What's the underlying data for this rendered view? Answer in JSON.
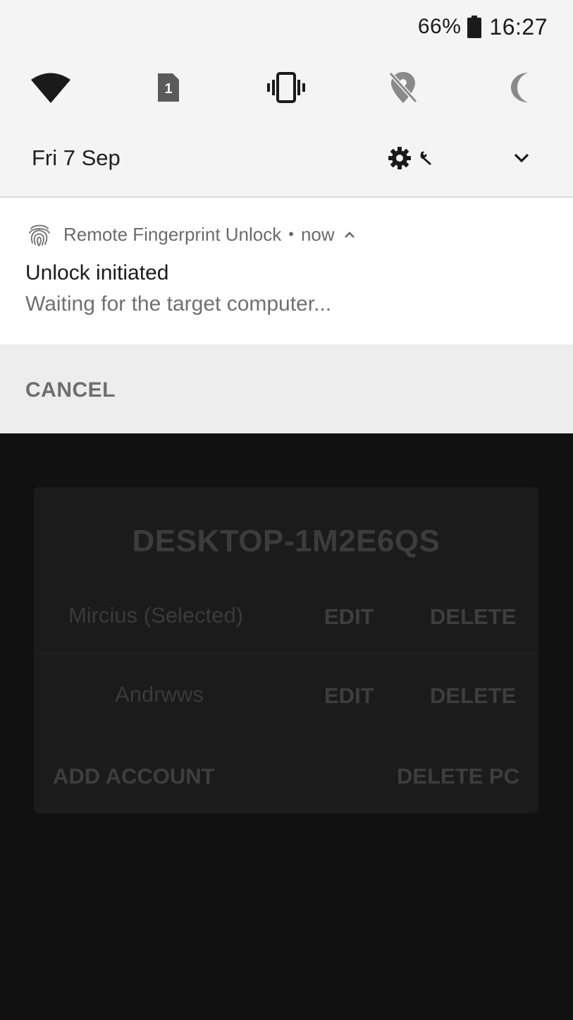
{
  "status_bar": {
    "battery_percent": "66%",
    "time": "16:27",
    "battery_icon": "battery-icon"
  },
  "quick_settings": {
    "tiles": [
      {
        "icon": "wifi-icon",
        "state": "on"
      },
      {
        "icon": "sim-card-icon",
        "label": "1",
        "state": "on"
      },
      {
        "icon": "vibrate-icon",
        "state": "on"
      },
      {
        "icon": "location-off-icon",
        "state": "off"
      },
      {
        "icon": "night-mode-icon",
        "state": "off"
      }
    ],
    "date": "Fri 7 Sep",
    "settings_icon": "settings-gear-icon",
    "expand_icon": "chevron-down-icon"
  },
  "notification": {
    "app_name": "Remote Fingerprint Unlock",
    "separator": "•",
    "time": "now",
    "title": "Unlock initiated",
    "text": "Waiting for the target computer...",
    "action_cancel": "CANCEL",
    "app_icon": "fingerprint-icon"
  },
  "app": {
    "pc_name": "DESKTOP-1M2E6QS",
    "accounts": [
      {
        "name": "Mircius (Selected)",
        "edit_label": "EDIT",
        "delete_label": "DELETE"
      },
      {
        "name": "Andrwws",
        "edit_label": "EDIT",
        "delete_label": "DELETE"
      }
    ],
    "add_account_label": "ADD ACCOUNT",
    "delete_pc_label": "DELETE PC"
  },
  "colors": {
    "shade_background": "#f4f4f4",
    "notification_background": "#ffffff",
    "action_bar_background": "#ededed",
    "app_background": "#111111",
    "card_background": "#1b1b1b"
  }
}
